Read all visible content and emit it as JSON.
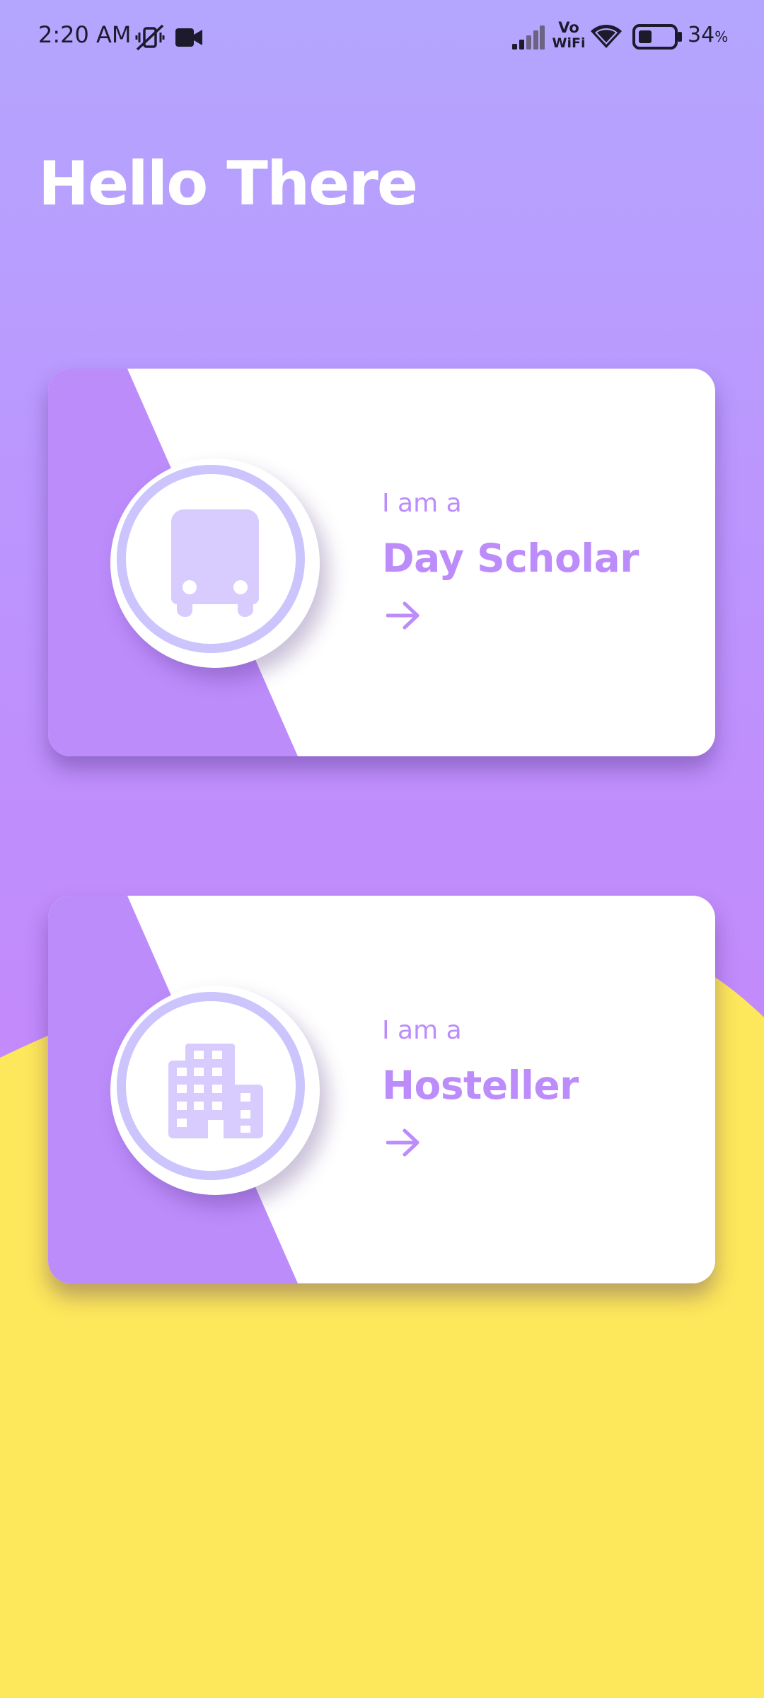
{
  "status_bar": {
    "time": "2:20 AM",
    "network_label_top": "Vo",
    "network_label_bottom": "WiFi",
    "battery_value": "34",
    "battery_unit": "%",
    "icons": [
      "mute-vibrate-icon",
      "video-camera-icon",
      "signal-bars-icon",
      "vowifi-icon",
      "wifi-icon",
      "battery-icon"
    ]
  },
  "greeting": "Hello There",
  "cards": [
    {
      "prefix": "I am a",
      "title": "Day Scholar",
      "icon": "bus-icon",
      "action_icon": "arrow-right-icon"
    },
    {
      "prefix": "I am a",
      "title": "Hosteller",
      "icon": "building-icon",
      "action_icon": "arrow-right-icon"
    }
  ],
  "colors": {
    "primary_purple": "#bc8cfb",
    "header_lavender": "#b4a6fe",
    "accent_yellow": "#fde75a",
    "icon_tint": "#ccc4fd",
    "card_background": "#ffffff"
  }
}
